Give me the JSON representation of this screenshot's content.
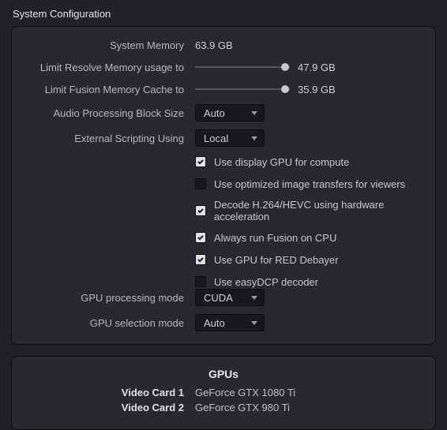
{
  "title": "System Configuration",
  "memory": {
    "system_label": "System Memory",
    "system_value": "63.9 GB",
    "resolve_label": "Limit Resolve Memory usage to",
    "resolve_value": "47.9 GB",
    "resolve_slider_pct": 95,
    "fusion_label": "Limit Fusion Memory Cache to",
    "fusion_value": "35.9 GB",
    "fusion_slider_pct": 95
  },
  "audio_block": {
    "label": "Audio Processing Block Size",
    "value": "Auto"
  },
  "scripting": {
    "label": "External Scripting Using",
    "value": "Local"
  },
  "checks": [
    {
      "name": "display-gpu-compute",
      "label": "Use display GPU for compute",
      "checked": true
    },
    {
      "name": "optimized-transfers",
      "label": "Use optimized image transfers for viewers",
      "checked": false
    },
    {
      "name": "hw-decode",
      "label": "Decode H.264/HEVC using hardware acceleration",
      "checked": true
    },
    {
      "name": "fusion-cpu",
      "label": "Always run Fusion on CPU",
      "checked": true
    },
    {
      "name": "gpu-red-debayer",
      "label": "Use GPU for RED Debayer",
      "checked": true
    },
    {
      "name": "easydcp",
      "label": "Use easyDCP decoder",
      "checked": false
    }
  ],
  "gpu_mode": {
    "label": "GPU processing mode",
    "value": "CUDA"
  },
  "gpu_select": {
    "label": "GPU selection mode",
    "value": "Auto"
  },
  "gpus": {
    "title": "GPUs",
    "cards": [
      {
        "label": "Video Card 1",
        "value": "GeForce GTX 1080 Ti"
      },
      {
        "label": "Video Card 2",
        "value": "GeForce GTX 980 Ti"
      }
    ]
  }
}
